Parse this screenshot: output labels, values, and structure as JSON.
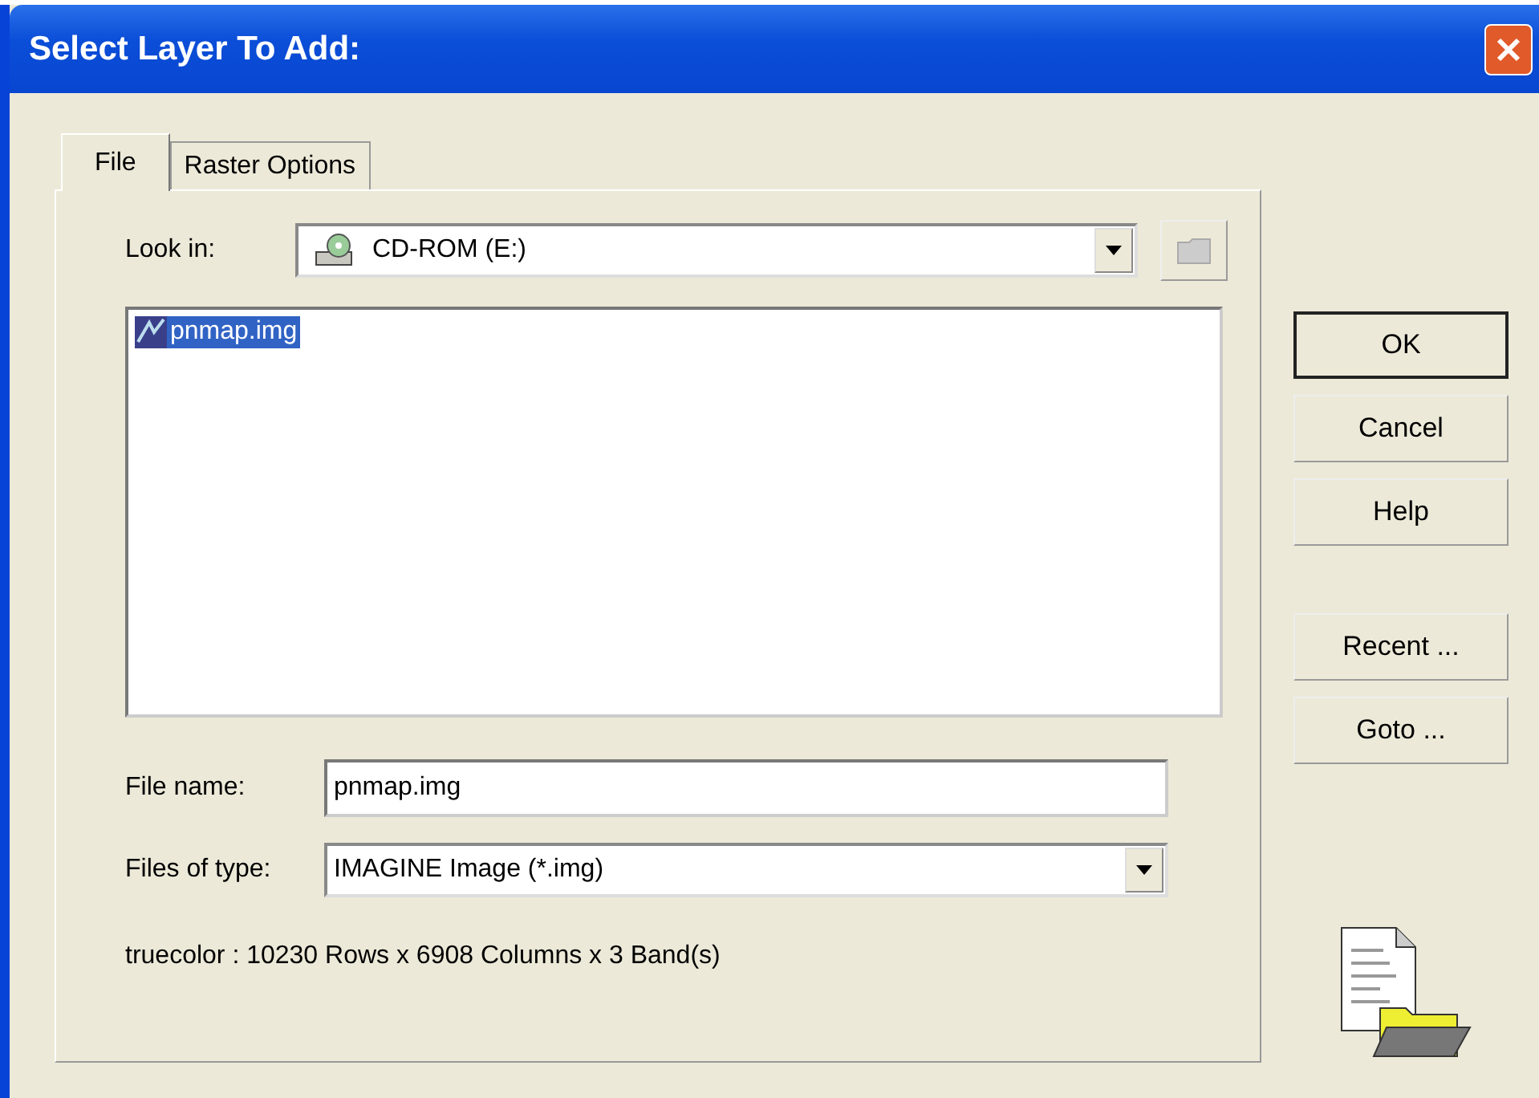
{
  "window": {
    "title": "Select Layer To Add:"
  },
  "tabs": [
    {
      "label": "File",
      "selected": true
    },
    {
      "label": "Raster Options",
      "selected": false
    }
  ],
  "look_in": {
    "label": "Look in:",
    "value": "CD-ROM (E:)"
  },
  "files": [
    {
      "name": "pnmap.img",
      "selected": true
    }
  ],
  "file_name": {
    "label": "File name:",
    "value": "pnmap.img"
  },
  "file_type": {
    "label": "Files of type:",
    "value": "IMAGINE Image (*.img)"
  },
  "info": "truecolor : 10230 Rows x 6908 Columns x 3 Band(s)",
  "buttons": [
    {
      "label": "OK",
      "default": true
    },
    {
      "label": "Cancel",
      "default": false
    },
    {
      "label": "Help",
      "default": false
    },
    {
      "label": "Recent ...",
      "default": false
    },
    {
      "label": "Goto ...",
      "default": false
    }
  ]
}
